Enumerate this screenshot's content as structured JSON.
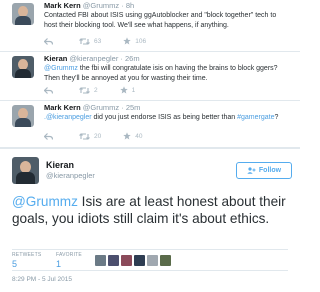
{
  "tweets": [
    {
      "name": "Mark Kern",
      "handle": "@Grummz",
      "time": "8h",
      "text_before": "Contacted FBI about ISIS using ggAutoblocker and \"block together\" tech to host their blocking tool. We'll see what happens, if anything.",
      "retweets": "63",
      "favorites": "106"
    },
    {
      "name": "Kieran",
      "handle": "@kieranpegler",
      "time": "26m",
      "mention": "@Grummz",
      "text_after": " the fbi will congratulate isis on having the brains to block ggers? Then they'll be annoyed at you for wasting their time.",
      "retweets": "2",
      "favorites": "1"
    },
    {
      "name": "Mark Kern",
      "handle": "@Grummz",
      "time": "25m",
      "mention": ".@kieranpegler",
      "text_middle": " did you just endorse ISIS as being better than ",
      "hashtag": "#gamergate",
      "text_end": "?",
      "retweets": "20",
      "favorites": "40"
    }
  ],
  "main_tweet": {
    "name": "Kieran",
    "handle": "@kieranpegler",
    "follow_label": "Follow",
    "mention": "@Grummz",
    "text": " Isis are at least honest about their goals, you idiots still claim it's about ethics.",
    "retweets_label": "RETWEETS",
    "retweets": "5",
    "favorites_label": "FAVORITE",
    "favorites": "1",
    "date": "8:29 PM - 5 Jul 2015"
  },
  "colors": {
    "link": "#55acee",
    "muted": "#8899a6",
    "divider": "#e1e8ed"
  },
  "icons": [
    "dot-separator",
    "reply-icon",
    "retweet-icon",
    "favorite-star-icon",
    "follow-person-icon"
  ]
}
